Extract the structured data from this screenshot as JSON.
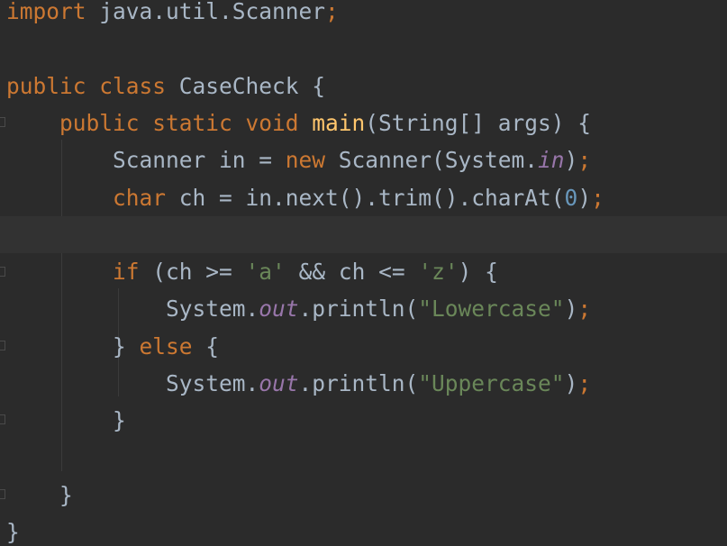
{
  "editor": {
    "language": "java",
    "theme": {
      "background": "#2b2b2b",
      "keyword": "#cc7832",
      "method": "#ffc66d",
      "string": "#6a8759",
      "number": "#6897bb",
      "static_field": "#9876aa",
      "text": "#a9b7c6"
    },
    "lines": [
      {
        "tokens": [
          {
            "t": "import",
            "c": "kw"
          },
          {
            "t": " java.util.Scanner",
            "c": ""
          },
          {
            "t": ";",
            "c": "kw"
          }
        ]
      },
      {
        "tokens": []
      },
      {
        "tokens": [
          {
            "t": "public class ",
            "c": "kw"
          },
          {
            "t": "CaseCheck {",
            "c": ""
          }
        ]
      },
      {
        "tokens": [
          {
            "t": "    ",
            "c": ""
          },
          {
            "t": "public static void ",
            "c": "kw"
          },
          {
            "t": "main",
            "c": "fn"
          },
          {
            "t": "(String[] args) {",
            "c": ""
          }
        ]
      },
      {
        "tokens": [
          {
            "t": "        Scanner in = ",
            "c": ""
          },
          {
            "t": "new ",
            "c": "kw"
          },
          {
            "t": "Scanner(System.",
            "c": ""
          },
          {
            "t": "in",
            "c": "stat"
          },
          {
            "t": ")",
            "c": ""
          },
          {
            "t": ";",
            "c": "kw"
          }
        ]
      },
      {
        "tokens": [
          {
            "t": "        ",
            "c": ""
          },
          {
            "t": "char ",
            "c": "kw"
          },
          {
            "t": "ch = in.next().trim().charAt(",
            "c": ""
          },
          {
            "t": "0",
            "c": "num"
          },
          {
            "t": ")",
            "c": ""
          },
          {
            "t": ";",
            "c": "kw"
          }
        ]
      },
      {
        "tokens": [],
        "current": true
      },
      {
        "tokens": [
          {
            "t": "        ",
            "c": ""
          },
          {
            "t": "if ",
            "c": "kw"
          },
          {
            "t": "(ch >= ",
            "c": ""
          },
          {
            "t": "'a' ",
            "c": "str"
          },
          {
            "t": "&& ch <= ",
            "c": ""
          },
          {
            "t": "'z'",
            "c": "str"
          },
          {
            "t": ") {",
            "c": ""
          }
        ]
      },
      {
        "tokens": [
          {
            "t": "            System.",
            "c": ""
          },
          {
            "t": "out",
            "c": "stat"
          },
          {
            "t": ".println(",
            "c": ""
          },
          {
            "t": "\"Lowercase\"",
            "c": "str"
          },
          {
            "t": ")",
            "c": ""
          },
          {
            "t": ";",
            "c": "kw"
          }
        ]
      },
      {
        "tokens": [
          {
            "t": "        } ",
            "c": ""
          },
          {
            "t": "else ",
            "c": "kw"
          },
          {
            "t": "{",
            "c": ""
          }
        ]
      },
      {
        "tokens": [
          {
            "t": "            System.",
            "c": ""
          },
          {
            "t": "out",
            "c": "stat"
          },
          {
            "t": ".println(",
            "c": ""
          },
          {
            "t": "\"Uppercase\"",
            "c": "str"
          },
          {
            "t": ")",
            "c": ""
          },
          {
            "t": ";",
            "c": "kw"
          }
        ]
      },
      {
        "tokens": [
          {
            "t": "        }",
            "c": ""
          }
        ]
      },
      {
        "tokens": []
      },
      {
        "tokens": [
          {
            "t": "    }",
            "c": ""
          }
        ]
      },
      {
        "tokens": [
          {
            "t": "}",
            "c": ""
          }
        ]
      }
    ]
  }
}
